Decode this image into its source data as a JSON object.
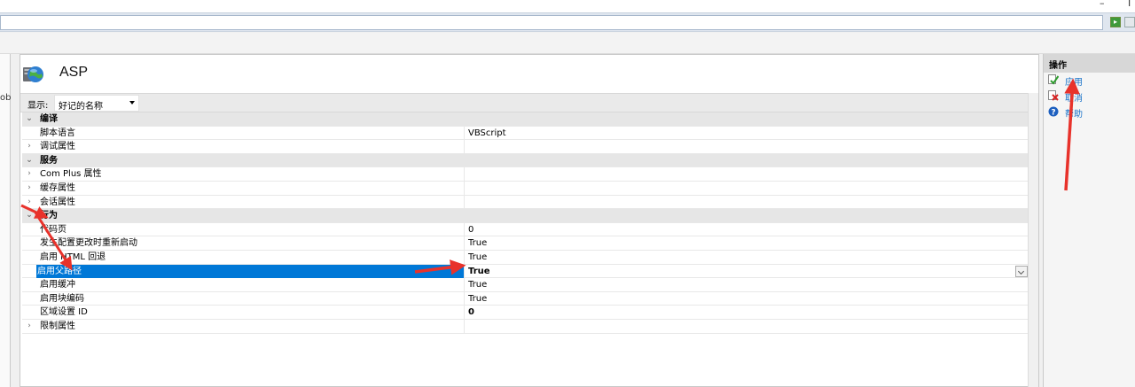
{
  "window": {
    "minimize_glyph": "–",
    "extra_glyph": "I"
  },
  "page": {
    "title": "ASP",
    "left_strip_fragment": "ob",
    "display": {
      "label": "显示:",
      "selected": "好记的名称"
    }
  },
  "grid": {
    "rows": [
      {
        "type": "category",
        "expander": "⌄",
        "name": "编译",
        "value": ""
      },
      {
        "type": "item",
        "expander": "",
        "name": "脚本语言",
        "value": "VBScript"
      },
      {
        "type": "item",
        "expander": "›",
        "name": "调试属性",
        "value": ""
      },
      {
        "type": "category",
        "expander": "⌄",
        "name": "服务",
        "value": ""
      },
      {
        "type": "item",
        "expander": "›",
        "name": "Com Plus 属性",
        "value": ""
      },
      {
        "type": "item",
        "expander": "›",
        "name": "缓存属性",
        "value": ""
      },
      {
        "type": "item",
        "expander": "›",
        "name": "会话属性",
        "value": ""
      },
      {
        "type": "category",
        "expander": "⌄",
        "name": "行为",
        "value": ""
      },
      {
        "type": "item",
        "expander": "",
        "name": "代码页",
        "value": "0"
      },
      {
        "type": "item",
        "expander": "",
        "name": "发生配置更改时重新启动",
        "value": "True"
      },
      {
        "type": "item",
        "expander": "",
        "name": "启用 HTML 回退",
        "value": "True"
      },
      {
        "type": "selected",
        "expander": "",
        "name": "启用父路径",
        "value": "True"
      },
      {
        "type": "item",
        "expander": "",
        "name": "启用缓冲",
        "value": "True"
      },
      {
        "type": "item",
        "expander": "",
        "name": "启用块编码",
        "value": "True"
      },
      {
        "type": "bold",
        "expander": "",
        "name": "区域设置 ID",
        "value": "0"
      },
      {
        "type": "item",
        "expander": "›",
        "name": "限制属性",
        "value": ""
      }
    ]
  },
  "actions": {
    "title": "操作",
    "items": [
      {
        "label": "应用",
        "icon": "apply-icon"
      },
      {
        "label": "取消",
        "icon": "cancel-icon"
      },
      {
        "label": "帮助",
        "icon": "help-icon"
      }
    ]
  },
  "annotation_color": "#e8322b",
  "selection_color": "#0078d7"
}
